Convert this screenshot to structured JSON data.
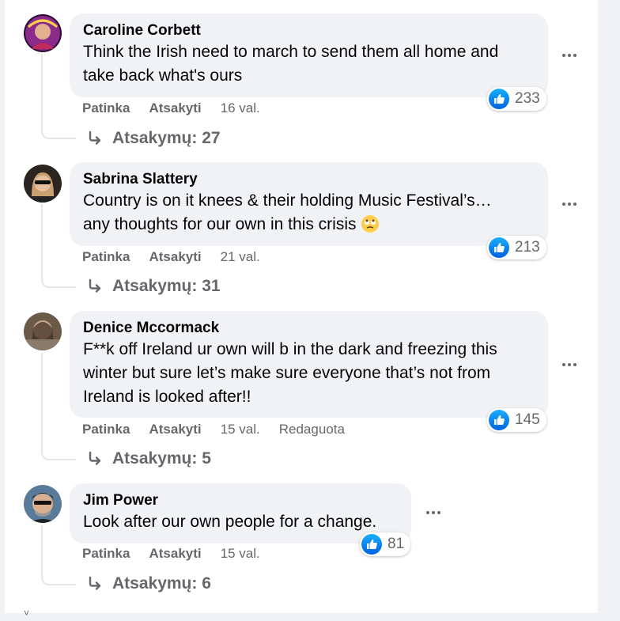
{
  "comments": [
    {
      "author": "Caroline Corbett",
      "text": "Think the Irish need to march to send them all home and\ntake back what's ours",
      "reaction_count": "233",
      "actions": {
        "like": "Patinka",
        "reply": "Atsakyti",
        "time": "16 val."
      },
      "replies_label": "Atsakymų: 27",
      "avatar_color": "#7a1f6e"
    },
    {
      "author": "Sabrina Slattery",
      "text": "Country is on it knees & their holding Music Festival’s…\nany thoughts for our own in this crisis",
      "emoji": "rolling-eyes-emoji",
      "reaction_count": "213",
      "actions": {
        "like": "Patinka",
        "reply": "Atsakyti",
        "time": "21 val."
      },
      "replies_label": "Atsakymų: 31",
      "avatar_color": "#3b3028"
    },
    {
      "author": "Denice Mccormack",
      "text": "F**k off Ireland ur own will b in the dark and freezing this\nwinter but sure let’s make sure everyone that’s not from\nIreland is looked after!!",
      "reaction_count": "145",
      "actions": {
        "like": "Patinka",
        "reply": "Atsakyti",
        "time": "15 val.",
        "edited": "Redaguota"
      },
      "replies_label": "Atsakymų: 5",
      "avatar_color": "#5a4a3a"
    },
    {
      "author": "Jim Power",
      "text": "Look after our own people for a change.",
      "reaction_count": "81",
      "actions": {
        "like": "Patinka",
        "reply": "Atsakyti",
        "time": "15 val."
      },
      "replies_label": "Atsakymų: 6",
      "avatar_color": "#4a6a8a"
    }
  ],
  "colors": {
    "bubble": "#f0f2f5",
    "like_blue": "#0866ff",
    "secondary_text": "#65676b"
  }
}
